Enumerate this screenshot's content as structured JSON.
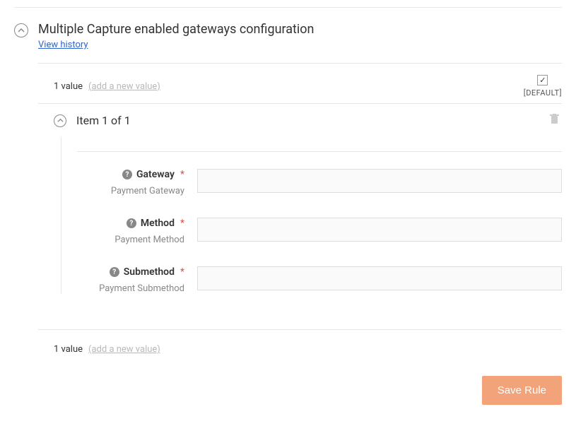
{
  "section": {
    "title": "Multiple Capture enabled gateways configuration",
    "viewHistory": "View history"
  },
  "values": {
    "topCount": "1 value",
    "addNew": "(add a new value)",
    "defaultLabel": "[DEFAULT]",
    "defaultCheck": "✓",
    "bottomCount": "1 value"
  },
  "item": {
    "title": "Item 1 of 1"
  },
  "fields": {
    "gateway": {
      "label": "Gateway",
      "sublabel": "Payment Gateway",
      "value": ""
    },
    "method": {
      "label": "Method",
      "sublabel": "Payment Method",
      "value": ""
    },
    "submethod": {
      "label": "Submethod",
      "sublabel": "Payment Submethod",
      "value": ""
    }
  },
  "buttons": {
    "save": "Save Rule"
  },
  "help": "?"
}
